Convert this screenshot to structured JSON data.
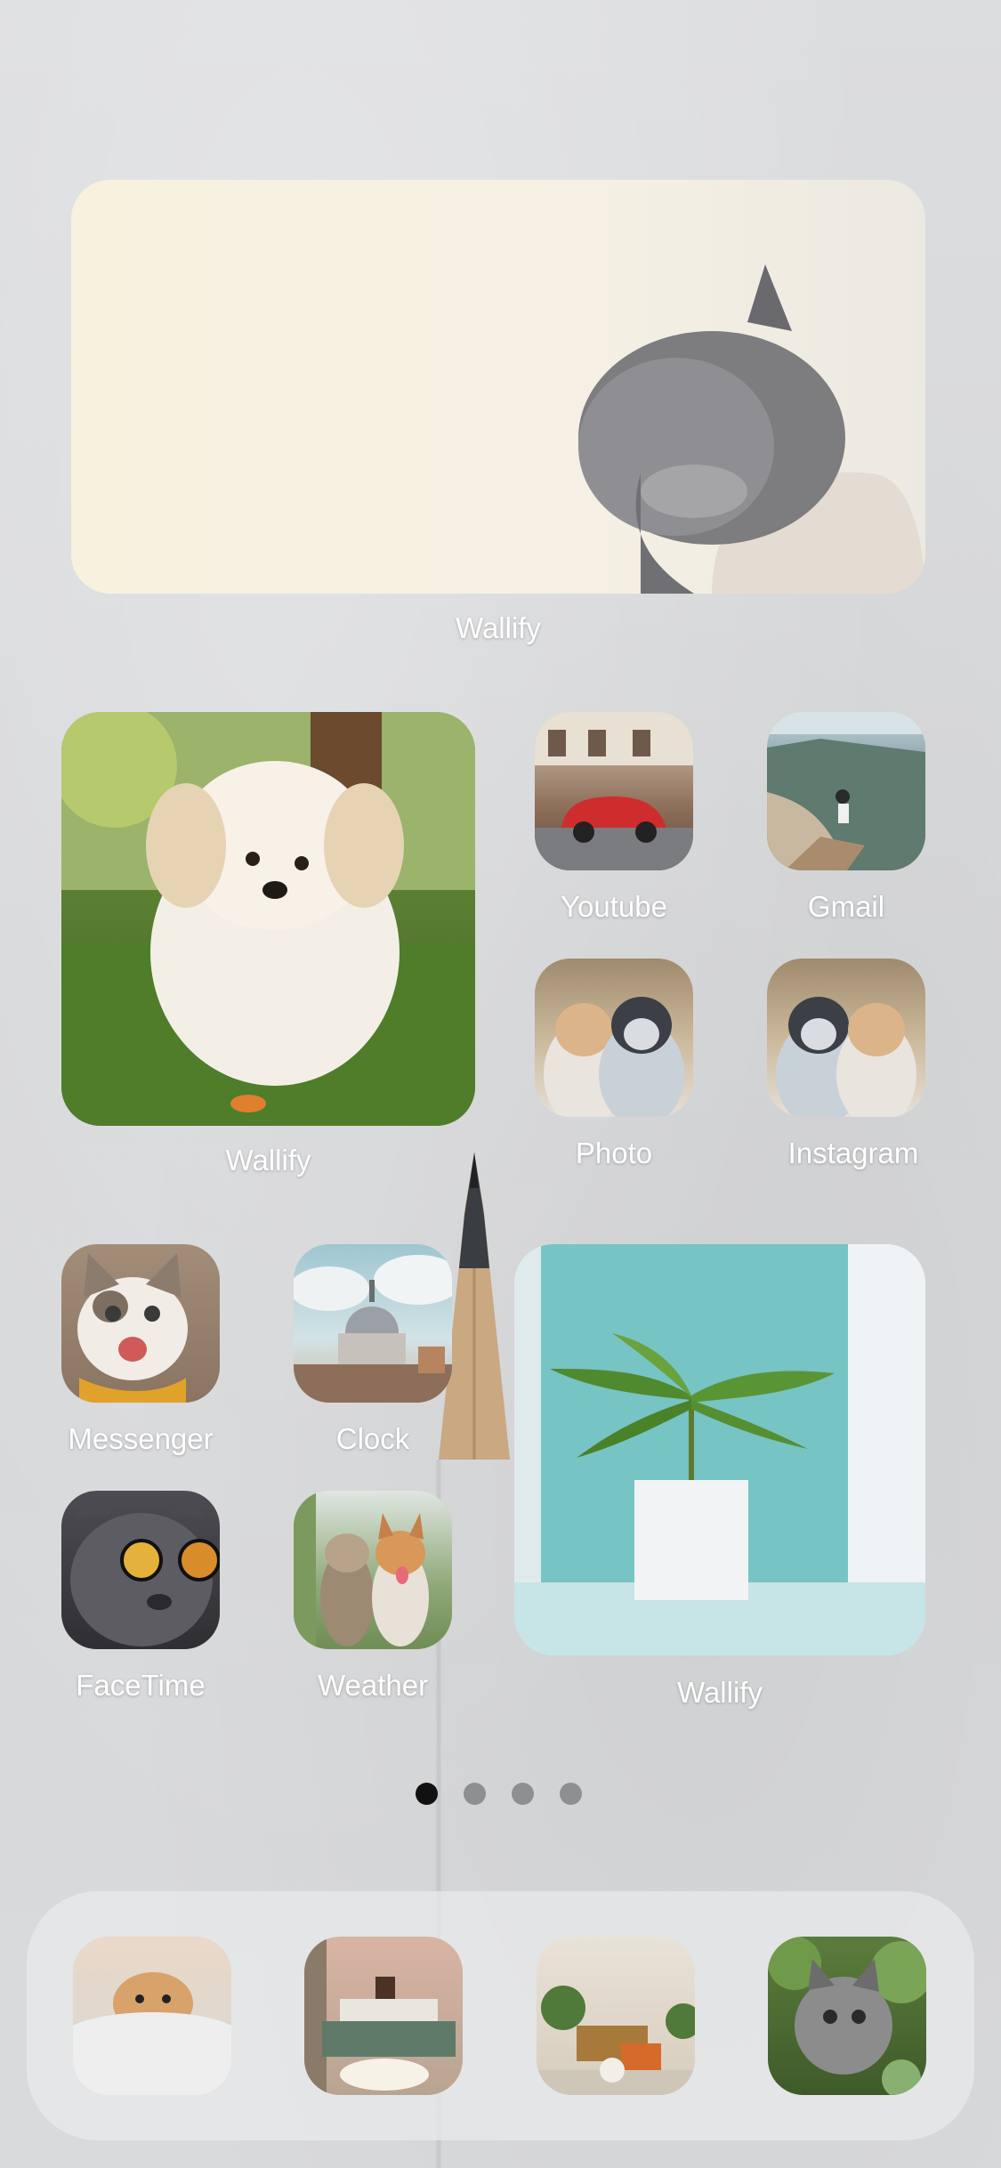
{
  "widgets": {
    "top": {
      "label": "Wallify",
      "subject": "grey kitten on hand"
    },
    "left": {
      "label": "Wallify",
      "subject": "white puppy running on grass"
    },
    "right": {
      "label": "Wallify",
      "subject": "palm plant in white pot, teal wall"
    }
  },
  "apps": {
    "youtube": {
      "label": "Youtube",
      "image": "red vintage car on street"
    },
    "gmail": {
      "label": "Gmail",
      "image": "woman sitting on cliff"
    },
    "photo": {
      "label": "Photo",
      "image": "two cats"
    },
    "instagram": {
      "label": "Instagram",
      "image": "two cats mirrored"
    },
    "messenger": {
      "label": "Messenger",
      "image": "happy cat with scarf"
    },
    "clock": {
      "label": "Clock",
      "image": "domed building with clouds"
    },
    "facetime": {
      "label": "FaceTime",
      "image": "cat with sunglasses"
    },
    "weather": {
      "label": "Weather",
      "image": "two dogs"
    }
  },
  "page_indicator": {
    "pages": 4,
    "current": 1
  },
  "dock": {
    "items": [
      {
        "image": "puppy in blanket"
      },
      {
        "image": "coffee table with cup"
      },
      {
        "image": "living room interior"
      },
      {
        "image": "tabby kitten in leaves"
      }
    ]
  },
  "colors": {
    "background": "#d9dadc",
    "label": "#ffffff",
    "dot_active": "#111111",
    "dot_inactive": "#8e8f92"
  }
}
